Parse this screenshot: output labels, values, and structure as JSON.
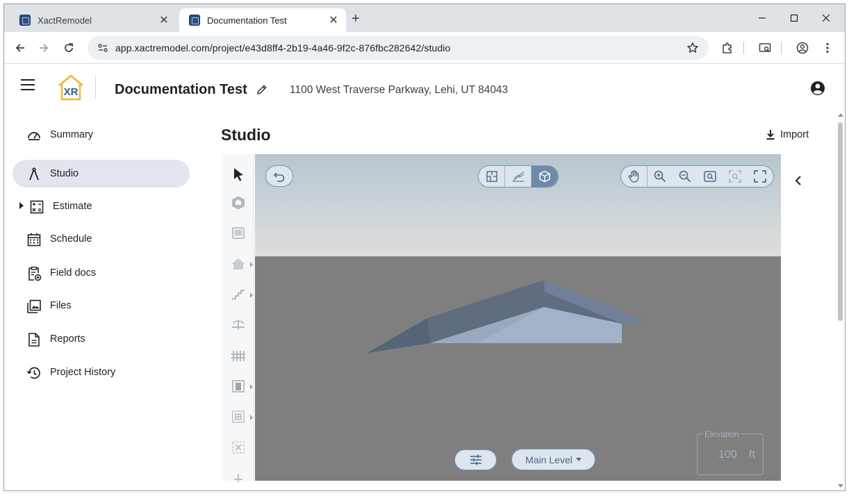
{
  "browser": {
    "tabs": [
      {
        "title": "XactRemodel",
        "active": false
      },
      {
        "title": "Documentation Test",
        "active": true
      }
    ],
    "url": "app.xactremodel.com/project/e43d8ff4-2b19-4a46-9f2c-876fbc282642/studio"
  },
  "header": {
    "logo_text": "XR",
    "project_title": "Documentation Test",
    "address": "1100 West Traverse Parkway, Lehi, UT 84043"
  },
  "sidebar": {
    "items": [
      {
        "label": "Summary",
        "icon": "gauge-icon"
      },
      {
        "label": "Studio",
        "icon": "compass-icon",
        "active": true
      },
      {
        "label": "Estimate",
        "icon": "calculator-icon",
        "expandable": true
      },
      {
        "label": "Schedule",
        "icon": "calendar-icon"
      },
      {
        "label": "Field docs",
        "icon": "clipboard-add-icon"
      },
      {
        "label": "Files",
        "icon": "image-stack-icon"
      },
      {
        "label": "Reports",
        "icon": "document-icon"
      },
      {
        "label": "Project History",
        "icon": "history-icon"
      }
    ]
  },
  "main": {
    "title": "Studio",
    "import_label": "Import"
  },
  "studio": {
    "view_modes": [
      "floor-plan-icon",
      "elevation-icon",
      "3d-cube-icon"
    ],
    "selected_view": "3d-cube-icon",
    "level": "Main Level",
    "elevation": {
      "label": "Elevation",
      "value": "100",
      "unit": "ft"
    }
  },
  "colors": {
    "accent": "#6f8aa8",
    "sidebar_active": "#e1e5ee",
    "ground": "#7f7f80"
  }
}
